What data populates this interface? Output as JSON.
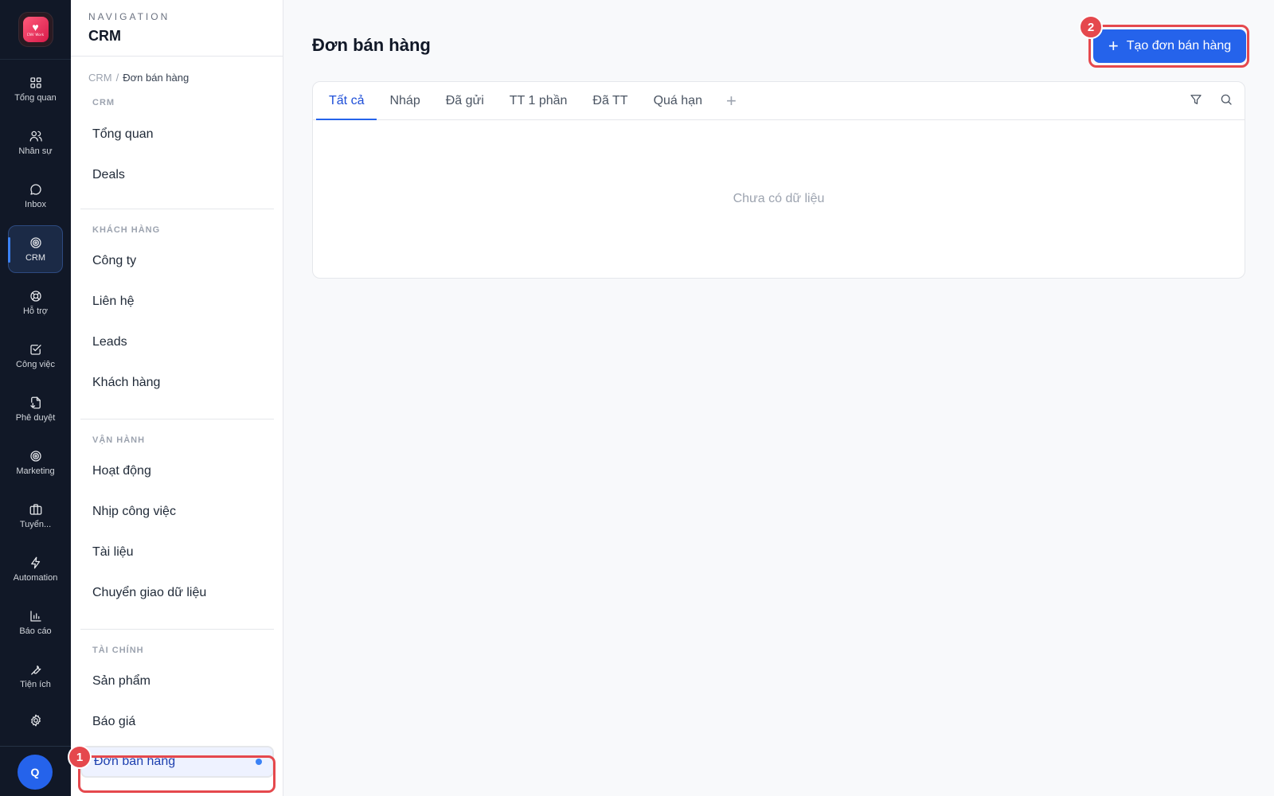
{
  "rail": {
    "logo_text": "CNV Work",
    "items": [
      {
        "label": "Tổng quan",
        "icon": "grid-icon"
      },
      {
        "label": "Nhân sự",
        "icon": "users-icon"
      },
      {
        "label": "Inbox",
        "icon": "chat-icon"
      },
      {
        "label": "CRM",
        "icon": "target-icon",
        "active": true
      },
      {
        "label": "Hỗ trợ",
        "icon": "lifebuoy-icon"
      },
      {
        "label": "Công việc",
        "icon": "checkbox-icon"
      },
      {
        "label": "Phê duyệt",
        "icon": "file-sign-icon"
      },
      {
        "label": "Marketing",
        "icon": "target-icon"
      },
      {
        "label": "Tuyển...",
        "icon": "briefcase-icon"
      },
      {
        "label": "Automation",
        "icon": "lightning-icon"
      },
      {
        "label": "Báo cáo",
        "icon": "bar-chart-icon"
      },
      {
        "label": "Tiện ích",
        "icon": "wrench-icon"
      }
    ],
    "settings_icon": "gear-icon",
    "avatar": "Q"
  },
  "nav": {
    "eyebrow": "NAVIGATION",
    "title": "CRM",
    "breadcrumb": {
      "root": "CRM",
      "sep": "/",
      "current": "Đơn bán hàng"
    },
    "sections": [
      {
        "label": "CRM",
        "items": [
          "Tổng quan",
          "Deals"
        ]
      },
      {
        "label": "KHÁCH HÀNG",
        "items": [
          "Công ty",
          "Liên hệ",
          "Leads",
          "Khách hàng"
        ]
      },
      {
        "label": "VẬN HÀNH",
        "items": [
          "Hoạt động",
          "Nhịp công việc",
          "Tài liệu",
          "Chuyển giao dữ liệu"
        ]
      },
      {
        "label": "TÀI CHÍNH",
        "items": [
          "Sản phẩm",
          "Báo giá"
        ]
      }
    ],
    "active_item": "Đơn bán hàng"
  },
  "main": {
    "title": "Đơn bán hàng",
    "create_button": {
      "icon": "+",
      "label": "Tạo đơn bán hàng"
    },
    "tabs": [
      "Tất cả",
      "Nháp",
      "Đã gửi",
      "TT 1 phần",
      "Đã TT",
      "Quá hạn"
    ],
    "active_tab": "Tất cả",
    "add_tab": "+",
    "empty_text": "Chưa có dữ liệu"
  },
  "annotations": {
    "step1": "1",
    "step2": "2"
  },
  "colors": {
    "accent": "#2563eb",
    "rail_bg": "#111827",
    "highlight": "#e5484d"
  }
}
